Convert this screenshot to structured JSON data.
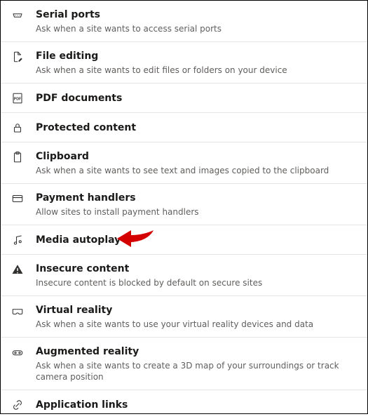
{
  "settings": [
    {
      "id": "serial-ports",
      "title": "Serial ports",
      "desc": "Ask when a site wants to access serial ports",
      "icon": "serial"
    },
    {
      "id": "file-editing",
      "title": "File editing",
      "desc": "Ask when a site wants to edit files or folders on your device",
      "icon": "file-edit"
    },
    {
      "id": "pdf-documents",
      "title": "PDF documents",
      "desc": "",
      "icon": "pdf"
    },
    {
      "id": "protected-content",
      "title": "Protected content",
      "desc": "",
      "icon": "lock"
    },
    {
      "id": "clipboard",
      "title": "Clipboard",
      "desc": "Ask when a site wants to see text and images copied to the clipboard",
      "icon": "clipboard"
    },
    {
      "id": "payment-handlers",
      "title": "Payment handlers",
      "desc": "Allow sites to install payment handlers",
      "icon": "card"
    },
    {
      "id": "media-autoplay",
      "title": "Media autoplay",
      "desc": "",
      "icon": "music",
      "highlight": true
    },
    {
      "id": "insecure-content",
      "title": "Insecure content",
      "desc": "Insecure content is blocked by default on secure sites",
      "icon": "warning"
    },
    {
      "id": "virtual-reality",
      "title": "Virtual reality",
      "desc": "Ask when a site wants to use your virtual reality devices and data",
      "icon": "vr"
    },
    {
      "id": "augmented-reality",
      "title": "Augmented reality",
      "desc": "Ask when a site wants to create a 3D map of your surroundings or track camera position",
      "icon": "ar"
    },
    {
      "id": "application-links",
      "title": "Application links",
      "desc": "",
      "icon": "link"
    }
  ],
  "arrow_color": "#d40000"
}
